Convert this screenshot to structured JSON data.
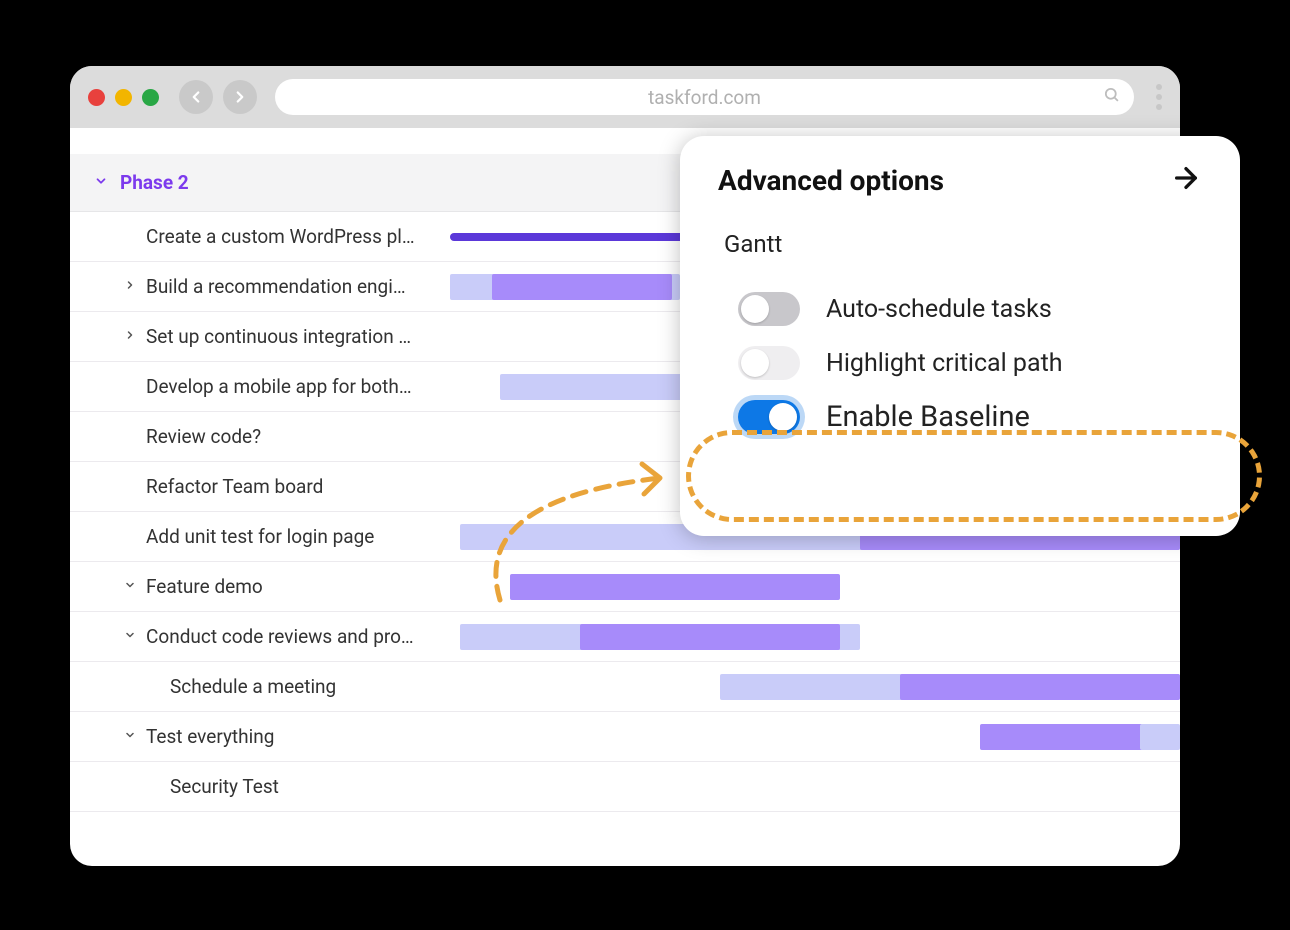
{
  "browser": {
    "url": "taskford.com"
  },
  "phase": {
    "title": "Phase 2"
  },
  "tasks": [
    {
      "label": "Create a custom WordPress plu…",
      "expandable": false,
      "indent": 0
    },
    {
      "label": "Build a recommendation engine …",
      "expandable": true,
      "arrow": "right",
      "indent": 0
    },
    {
      "label": "Set up continuous integration an…",
      "expandable": true,
      "arrow": "right",
      "indent": 0
    },
    {
      "label": "Develop a mobile app for both iO…",
      "expandable": false,
      "indent": 0
    },
    {
      "label": "Review code?",
      "expandable": false,
      "indent": 0
    },
    {
      "label": "Refactor Team board",
      "expandable": false,
      "indent": 0
    },
    {
      "label": "Add unit test for login page",
      "expandable": false,
      "indent": 0
    },
    {
      "label": "Feature demo",
      "expandable": true,
      "arrow": "down",
      "indent": 0
    },
    {
      "label": "Conduct code reviews and provi…",
      "expandable": true,
      "arrow": "down",
      "indent": 0
    },
    {
      "label": "Schedule a meeting",
      "expandable": false,
      "indent": 1
    },
    {
      "label": "Test everything",
      "expandable": true,
      "arrow": "down",
      "indent": 0
    },
    {
      "label": "Security Test",
      "expandable": false,
      "indent": 1
    }
  ],
  "advanced": {
    "title": "Advanced options",
    "section": "Gantt",
    "options": [
      {
        "label": "Auto-schedule tasks",
        "on": false,
        "style": "gray"
      },
      {
        "label": "Highlight critical path",
        "on": false,
        "style": "light"
      },
      {
        "label": "Enable Baseline",
        "on": true,
        "style": "blue"
      }
    ]
  },
  "colors": {
    "accent_purple": "#7c3aed",
    "bar_dark": "#5b38d9",
    "bar_mid": "#a78bfa",
    "bar_light": "#c9ccf9",
    "toggle_on": "#0d78e6",
    "highlight": "#e9a43a"
  }
}
